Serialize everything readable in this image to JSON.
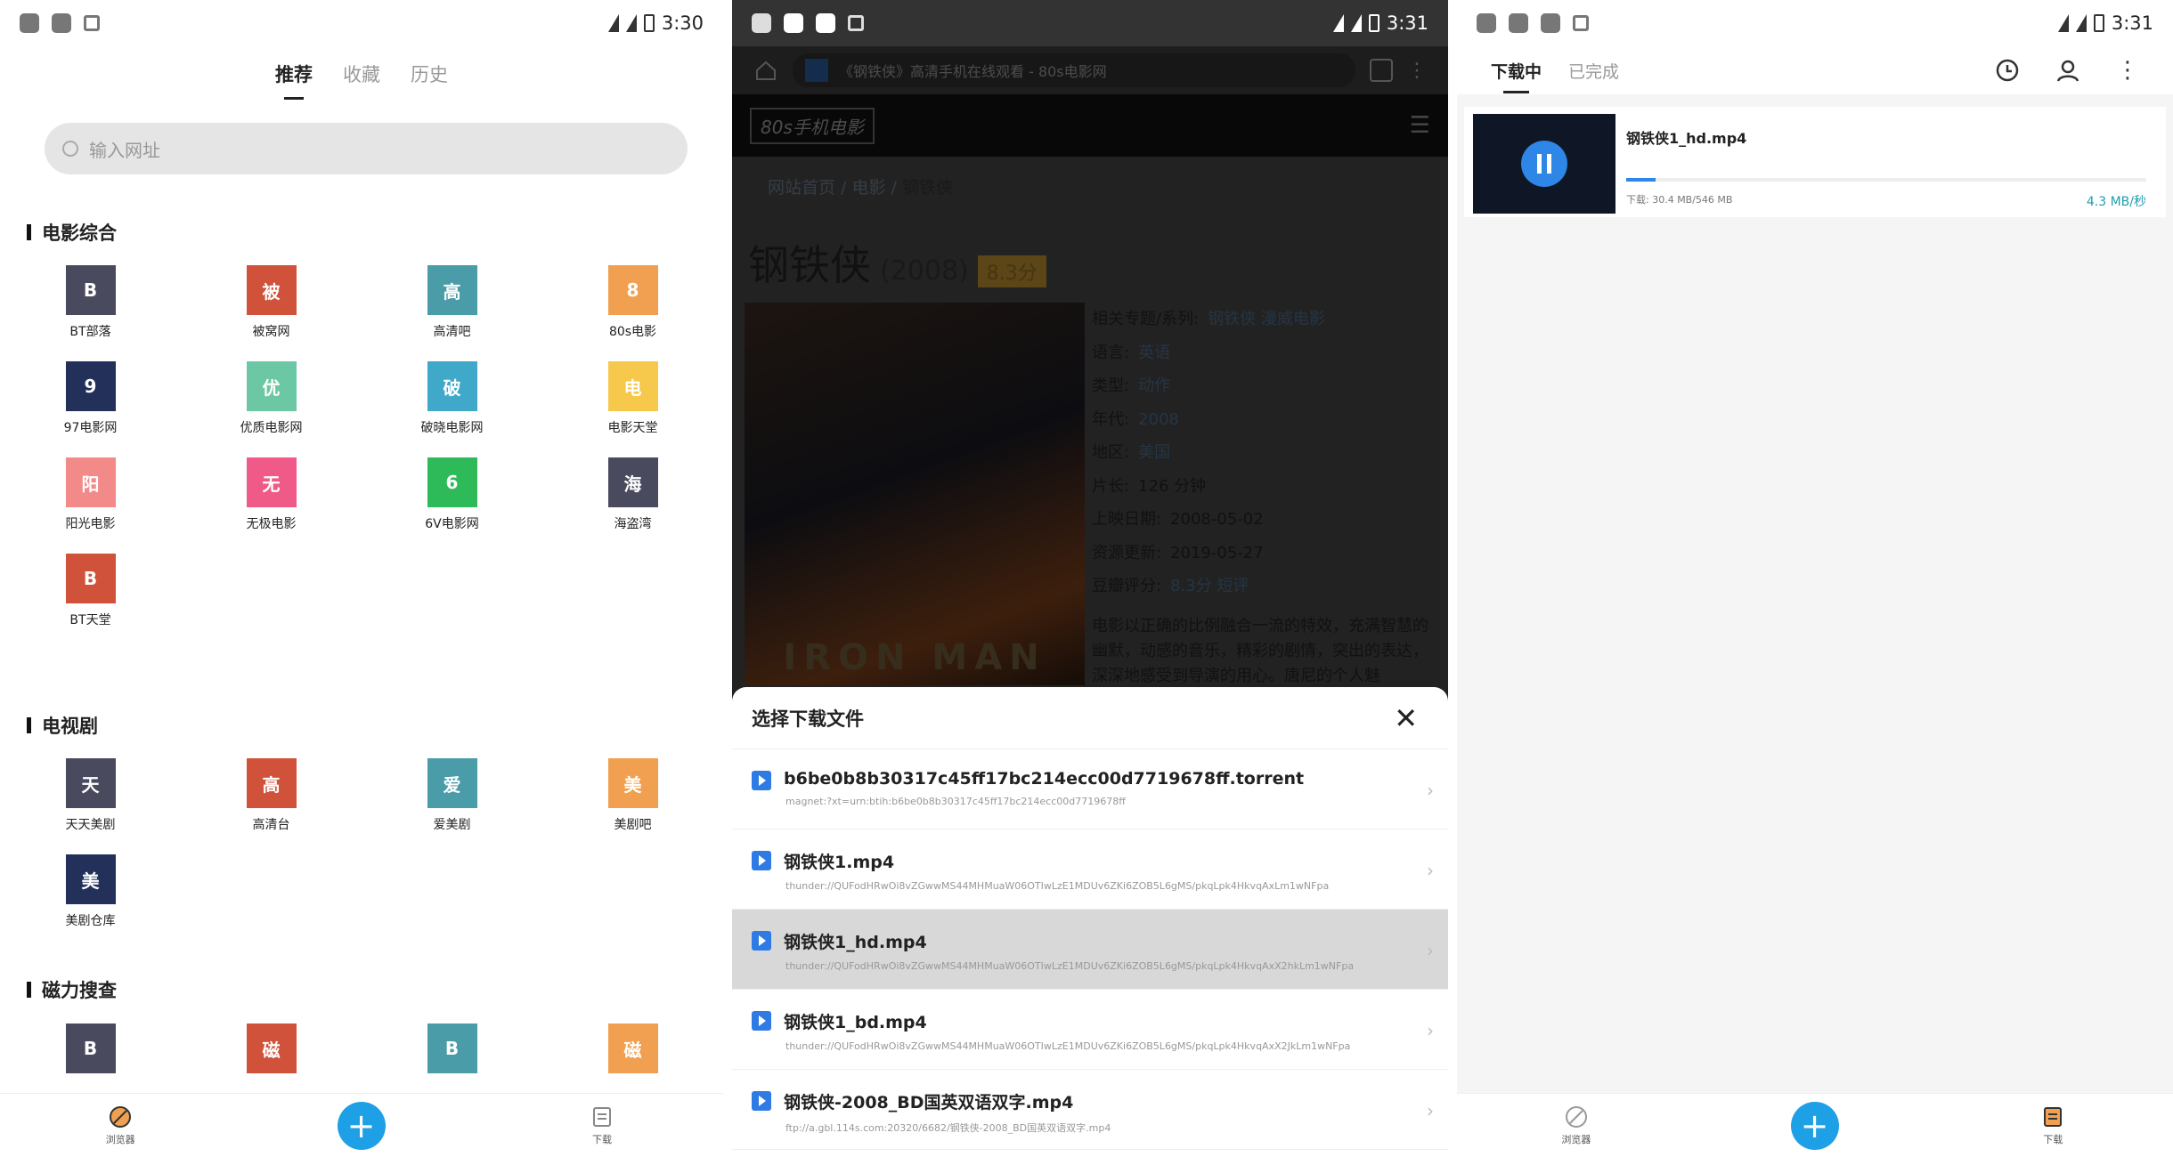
{
  "status": {
    "p1_time": "3:30",
    "p2_time": "3:31",
    "p3_time": "3:31"
  },
  "browser_home": {
    "tabs": [
      "推荐",
      "收藏",
      "历史"
    ],
    "url_placeholder": "输入网址",
    "sections": [
      {
        "title": "电影综合",
        "items": [
          {
            "icon": "B",
            "label": "BT部落",
            "color": "#4a4a5e"
          },
          {
            "icon": "被",
            "label": "被窝网",
            "color": "#d0523a"
          },
          {
            "icon": "高",
            "label": "高清吧",
            "color": "#4a9ca8"
          },
          {
            "icon": "8",
            "label": "80s电影",
            "color": "#f0a050"
          },
          {
            "icon": "9",
            "label": "97电影网",
            "color": "#22305a"
          },
          {
            "icon": "优",
            "label": "优质电影网",
            "color": "#6cc7a4"
          },
          {
            "icon": "破",
            "label": "破晓电影网",
            "color": "#40a8c8"
          },
          {
            "icon": "电",
            "label": "电影天堂",
            "color": "#f6c84c"
          },
          {
            "icon": "阳",
            "label": "阳光电影",
            "color": "#f28a8a"
          },
          {
            "icon": "无",
            "label": "无极电影",
            "color": "#f05a88"
          },
          {
            "icon": "6",
            "label": "6V电影网",
            "color": "#2fba5a"
          },
          {
            "icon": "海",
            "label": "海盗湾",
            "color": "#4a4a5e"
          },
          {
            "icon": "B",
            "label": "BT天堂",
            "color": "#d0523a"
          }
        ]
      },
      {
        "title": "电视剧",
        "items": [
          {
            "icon": "天",
            "label": "天天美剧",
            "color": "#4a4a5e"
          },
          {
            "icon": "高",
            "label": "高清台",
            "color": "#d0523a"
          },
          {
            "icon": "爱",
            "label": "爱美剧",
            "color": "#4a9ca8"
          },
          {
            "icon": "美",
            "label": "美剧吧",
            "color": "#f0a050"
          },
          {
            "icon": "美",
            "label": "美剧仓库",
            "color": "#22305a"
          }
        ]
      },
      {
        "title": "磁力搜查",
        "items": [
          {
            "icon": "B",
            "label": "",
            "color": "#4a4a5e"
          },
          {
            "icon": "磁",
            "label": "",
            "color": "#d0523a"
          },
          {
            "icon": "B",
            "label": "",
            "color": "#4a9ca8"
          },
          {
            "icon": "磁",
            "label": "",
            "color": "#f0a050"
          }
        ]
      }
    ],
    "nav": {
      "browser": "浏览器",
      "download": "下载"
    }
  },
  "webpage": {
    "page_title": "《钢铁侠》高清手机在线观看 - 80s电影网",
    "site_logo": "80s手机电影",
    "breadcrumb": [
      "网站首页",
      "电影",
      "钢铁侠"
    ],
    "movie_title": "钢铁侠",
    "year": "(2008)",
    "score": "8.3分",
    "poster_text": "IRON MAN",
    "info": [
      {
        "k": "相关专题/系列:",
        "v": "钢铁侠  漫威电影",
        "link": true
      },
      {
        "k": "语言:",
        "v": "英语",
        "link": true
      },
      {
        "k": "类型:",
        "v": "动作",
        "link": true
      },
      {
        "k": "年代:",
        "v": "2008",
        "link": true
      },
      {
        "k": "地区:",
        "v": "美国",
        "link": true
      },
      {
        "k": "片长:",
        "v": "126 分钟",
        "link": false
      },
      {
        "k": "上映日期:",
        "v": "2008-05-02",
        "link": false
      },
      {
        "k": "资源更新:",
        "v": "2019-05-27",
        "link": false
      },
      {
        "k": "豆瓣评分:",
        "v": "8.3分  短评",
        "link": true
      }
    ],
    "description": "电影以正确的比例融合一流的特效，充满智慧的幽默，动感的音乐，精彩的剧情，突出的表达，深深地感受到导演的用心。唐尼的个人魅"
  },
  "download_sheet": {
    "title": "选择下载文件",
    "files": [
      {
        "name": "b6be0b8b30317c45ff17bc214ecc00d7719678ff.torrent",
        "url": "magnet:?xt=urn:btih:b6be0b8b30317c45ff17bc214ecc00d7719678ff",
        "selected": false
      },
      {
        "name": "钢铁侠1.mp4",
        "url": "thunder://QUFodHRwOi8vZGwwMS44MHMuaW06OTIwLzE1MDUv6ZKi6ZOB5L6gMS/pkqLpk4HkvqAxLm1wNFpa",
        "selected": false
      },
      {
        "name": "钢铁侠1_hd.mp4",
        "url": "thunder://QUFodHRwOi8vZGwwMS44MHMuaW06OTIwLzE1MDUv6ZKi6ZOB5L6gMS/pkqLpk4HkvqAxX2hkLm1wNFpa",
        "selected": true
      },
      {
        "name": "钢铁侠1_bd.mp4",
        "url": "thunder://QUFodHRwOi8vZGwwMS44MHMuaW06OTIwLzE1MDUv6ZKi6ZOB5L6gMS/pkqLpk4HkvqAxX2JkLm1wNFpa",
        "selected": false
      },
      {
        "name": "钢铁侠-2008_BD国英双语双字.mp4",
        "url": "ftp://a.gbl.114s.com:20320/6682/钢铁侠-2008_BD国英双语双字.mp4",
        "selected": false
      }
    ]
  },
  "downloads": {
    "tabs": [
      "下载中",
      "已完成"
    ],
    "item": {
      "name": "钢铁侠1_hd.mp4",
      "progress_label": "下载: 30.4 MB/546 MB",
      "progress": 0.056,
      "speed": "4.3 MB/秒"
    },
    "nav": {
      "browser": "浏览器",
      "download": "下载"
    }
  }
}
